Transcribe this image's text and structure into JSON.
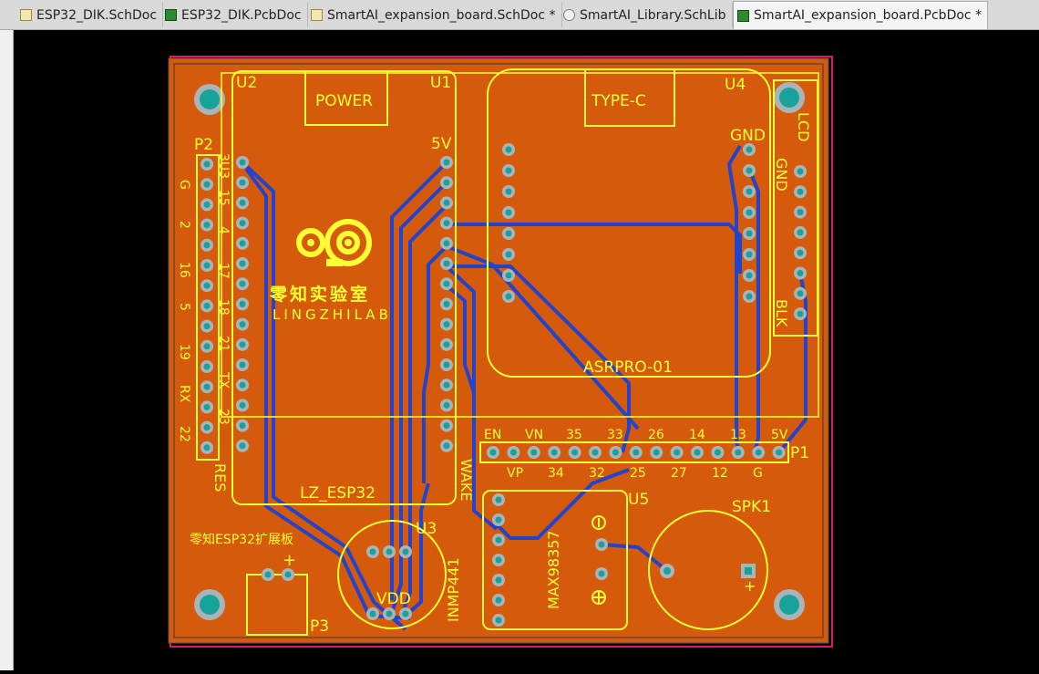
{
  "tabs": [
    {
      "label": "ESP32_DIK.SchDoc",
      "type": "sch",
      "active": false
    },
    {
      "label": "ESP32_DIK.PcbDoc",
      "type": "pcb",
      "active": false
    },
    {
      "label": "SmartAI_expansion_board.SchDoc *",
      "type": "sch",
      "active": false
    },
    {
      "label": "SmartAI_Library.SchLib",
      "type": "lib",
      "active": false
    },
    {
      "label": "SmartAI_expansion_board.PcbDoc *",
      "type": "pcb",
      "active": true
    }
  ],
  "colors": {
    "board": "#d55a0b",
    "silk": "#ffff33",
    "trace": "#2244cc",
    "pad": "#aab3b8",
    "via": "#17a39a",
    "outline": "#e01868",
    "bg": "#000000"
  },
  "board": {
    "designators": {
      "u2": "U2",
      "u1": "U1",
      "u4": "U4",
      "u3": "U3",
      "u5": "U5",
      "p1": "P1",
      "p2": "P2",
      "p3": "P3",
      "spk1": "SPK1"
    },
    "labels": {
      "power": "POWER",
      "type_c": "TYPE-C",
      "lz_esp32": "LZ_ESP32",
      "asrpro": "ASRPRO-01",
      "logo_cn": "零知实验室",
      "logo_en": "LINGZHILAB",
      "board_cn": "零知ESP32扩展板",
      "vdd": "VDD",
      "inmp441": "INMP441",
      "max98357": "MAX98357",
      "wake": "WAKE",
      "five_v_u1": "5V",
      "gnd_a": "GND",
      "gnd_b": "GND",
      "lcd": "LCD",
      "blk": "BLK",
      "res": "RES",
      "spk_plus": "+",
      "p3_plus": "+"
    },
    "p2_inner": [
      "3U3",
      "15",
      "4",
      "17",
      "18",
      "21",
      "TX",
      "23"
    ],
    "p2_outer": [
      "G",
      "2",
      "16",
      "5",
      "19",
      "RX",
      "22"
    ],
    "p1_top": [
      "EN",
      "VN",
      "35",
      "33",
      "26",
      "14",
      "13",
      "5V"
    ],
    "p1_bottom": [
      "VP",
      "34",
      "32",
      "25",
      "27",
      "12",
      "G"
    ]
  }
}
